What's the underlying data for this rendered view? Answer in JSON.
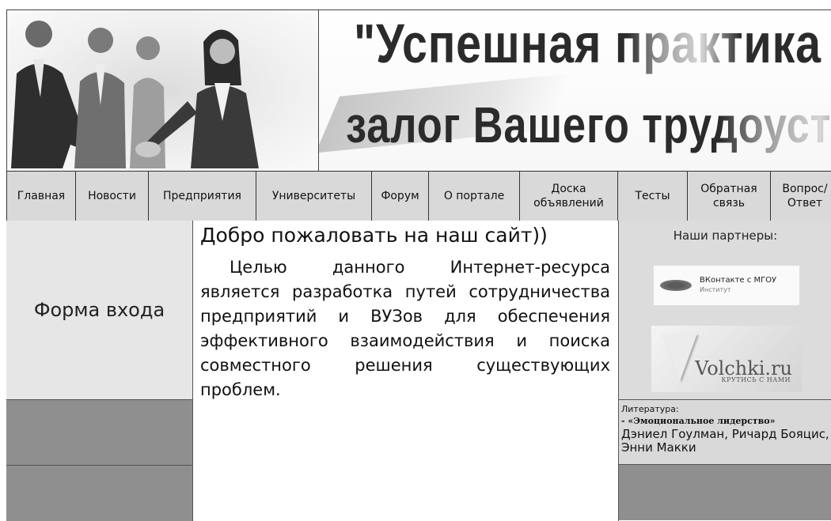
{
  "header": {
    "title_line1": "\"Успешная практика -",
    "title_line2": "залог Вашего трудоустройства\""
  },
  "nav": [
    "Главная",
    "Новости",
    "Предприятия",
    "Университеты",
    "Форум",
    "О портале",
    "Доска объявлений",
    "Тесты",
    "Обратная связь",
    "Вопрос/ Ответ"
  ],
  "sidebar": {
    "login_label": "Форма входа"
  },
  "main": {
    "heading": "Добро пожаловать на наш сайт))",
    "text": "Целью данного Интернет-ресурса является разработка путей сотрудничества предприятий и ВУЗов для обеспечения эффективного взаимодействия и поиска совместного решения существующих проблем."
  },
  "partners": {
    "title": "Наши партнеры:",
    "vk_line1": "ВКонтакте с МГОУ",
    "vk_line2": "Институт",
    "volchki_name": "Volchki.ru",
    "volchki_slogan": "КРУТИСЬ С НАМИ"
  },
  "literature": {
    "label": "Литература:",
    "book": "- «Эмоциональное лидерство»",
    "authors": "Дэниел Гоулман, Ричард Бояцис, Энни Макки"
  }
}
